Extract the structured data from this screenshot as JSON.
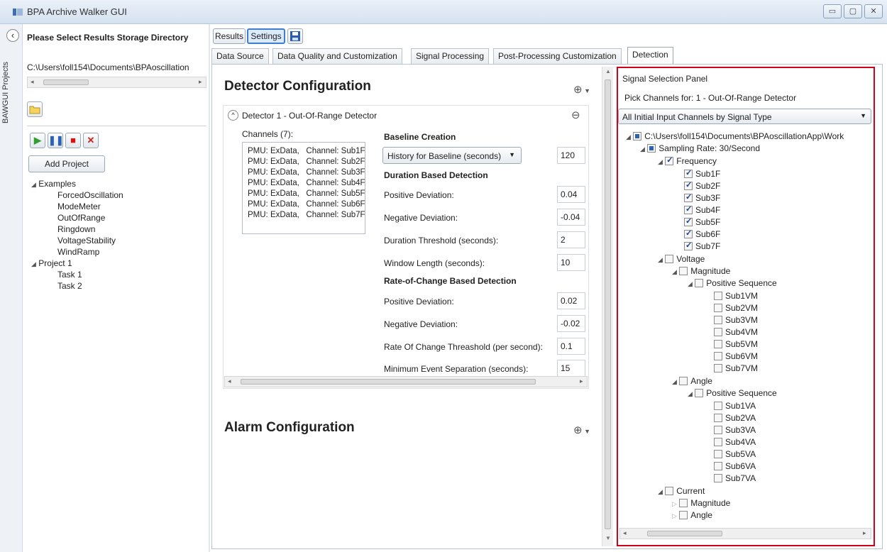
{
  "window": {
    "title": "BPA Archive Walker GUI"
  },
  "side_tab": {
    "label": "BAWGUI Projects"
  },
  "left_panel": {
    "heading": "Please Select Results Storage Directory",
    "path": "C:\\Users\\foll154\\Documents\\BPAoscillation",
    "add_project_label": "Add Project",
    "tree": {
      "examples_label": "Examples",
      "examples": [
        "ForcedOscillation",
        "ModeMeter",
        "OutOfRange",
        "Ringdown",
        "VoltageStability",
        "WindRamp"
      ],
      "project_label": "Project 1",
      "tasks": [
        "Task 1",
        "Task 2"
      ]
    }
  },
  "toolbar": {
    "results_label": "Results",
    "settings_label": "Settings"
  },
  "tabs": [
    "Data Source",
    "Data Quality and Customization",
    "Signal Processing",
    "Post-Processing Customization",
    "Detection"
  ],
  "detector": {
    "section_title": "Detector Configuration",
    "detector_title": "Detector 1 - Out-Of-Range Detector",
    "channels_label": "Channels (7):",
    "channels": [
      "PMU: ExData,   Channel: Sub1F",
      "PMU: ExData,   Channel: Sub2F",
      "PMU: ExData,   Channel: Sub3F",
      "PMU: ExData,   Channel: Sub4F",
      "PMU: ExData,   Channel: Sub5F",
      "PMU: ExData,   Channel: Sub6F",
      "PMU: ExData,   Channel: Sub7F"
    ],
    "baseline_heading": "Baseline Creation",
    "baseline_select": "History for Baseline (seconds)",
    "baseline_value": "120",
    "duration_heading": "Duration Based Detection",
    "dur_pos_label": "Positive Deviation:",
    "dur_pos_value": "0.04",
    "dur_neg_label": "Negative Deviation:",
    "dur_neg_value": "-0.04",
    "dur_thresh_label": "Duration Threshold (seconds):",
    "dur_thresh_value": "2",
    "window_label": "Window Length (seconds):",
    "window_value": "10",
    "roc_heading": "Rate-of-Change Based Detection",
    "roc_pos_label": "Positive Deviation:",
    "roc_pos_value": "0.02",
    "roc_neg_label": "Negative Deviation:",
    "roc_neg_value": "-0.02",
    "roc_thresh_label": "Rate Of Change Threashold (per second):",
    "roc_thresh_value": "0.1",
    "min_sep_label": "Minimum Event Separation (seconds):",
    "min_sep_value": "15"
  },
  "alarm": {
    "section_title": "Alarm Configuration"
  },
  "signal_panel": {
    "title": "Signal Selection Panel",
    "pick_label": "Pick Channels for: 1 - Out-Of-Range Detector",
    "dropdown": "All Initial Input Channels by Signal Type",
    "root": "C:\\Users\\foll154\\Documents\\BPAoscillationApp\\Work",
    "rate": "Sampling Rate: 30/Second",
    "frequency": "Frequency",
    "freq_items": [
      "Sub1F",
      "Sub2F",
      "Sub3F",
      "Sub4F",
      "Sub5F",
      "Sub6F",
      "Sub7F"
    ],
    "voltage": "Voltage",
    "magnitude": "Magnitude",
    "pos_seq": "Positive Sequence",
    "vm_items": [
      "Sub1VM",
      "Sub2VM",
      "Sub3VM",
      "Sub4VM",
      "Sub5VM",
      "Sub6VM",
      "Sub7VM"
    ],
    "angle": "Angle",
    "pos_seq2": "Positive Sequence",
    "va_items": [
      "Sub1VA",
      "Sub2VA",
      "Sub3VA",
      "Sub4VA",
      "Sub5VA",
      "Sub6VA",
      "Sub7VA"
    ],
    "current": "Current",
    "cur_magnitude": "Magnitude",
    "cur_angle": "Angle"
  },
  "colors": {
    "highlight_border": "#d0021b",
    "accent_play": "#2e9e2e",
    "accent_pause": "#2a62b5",
    "accent_stop": "#e01010"
  }
}
